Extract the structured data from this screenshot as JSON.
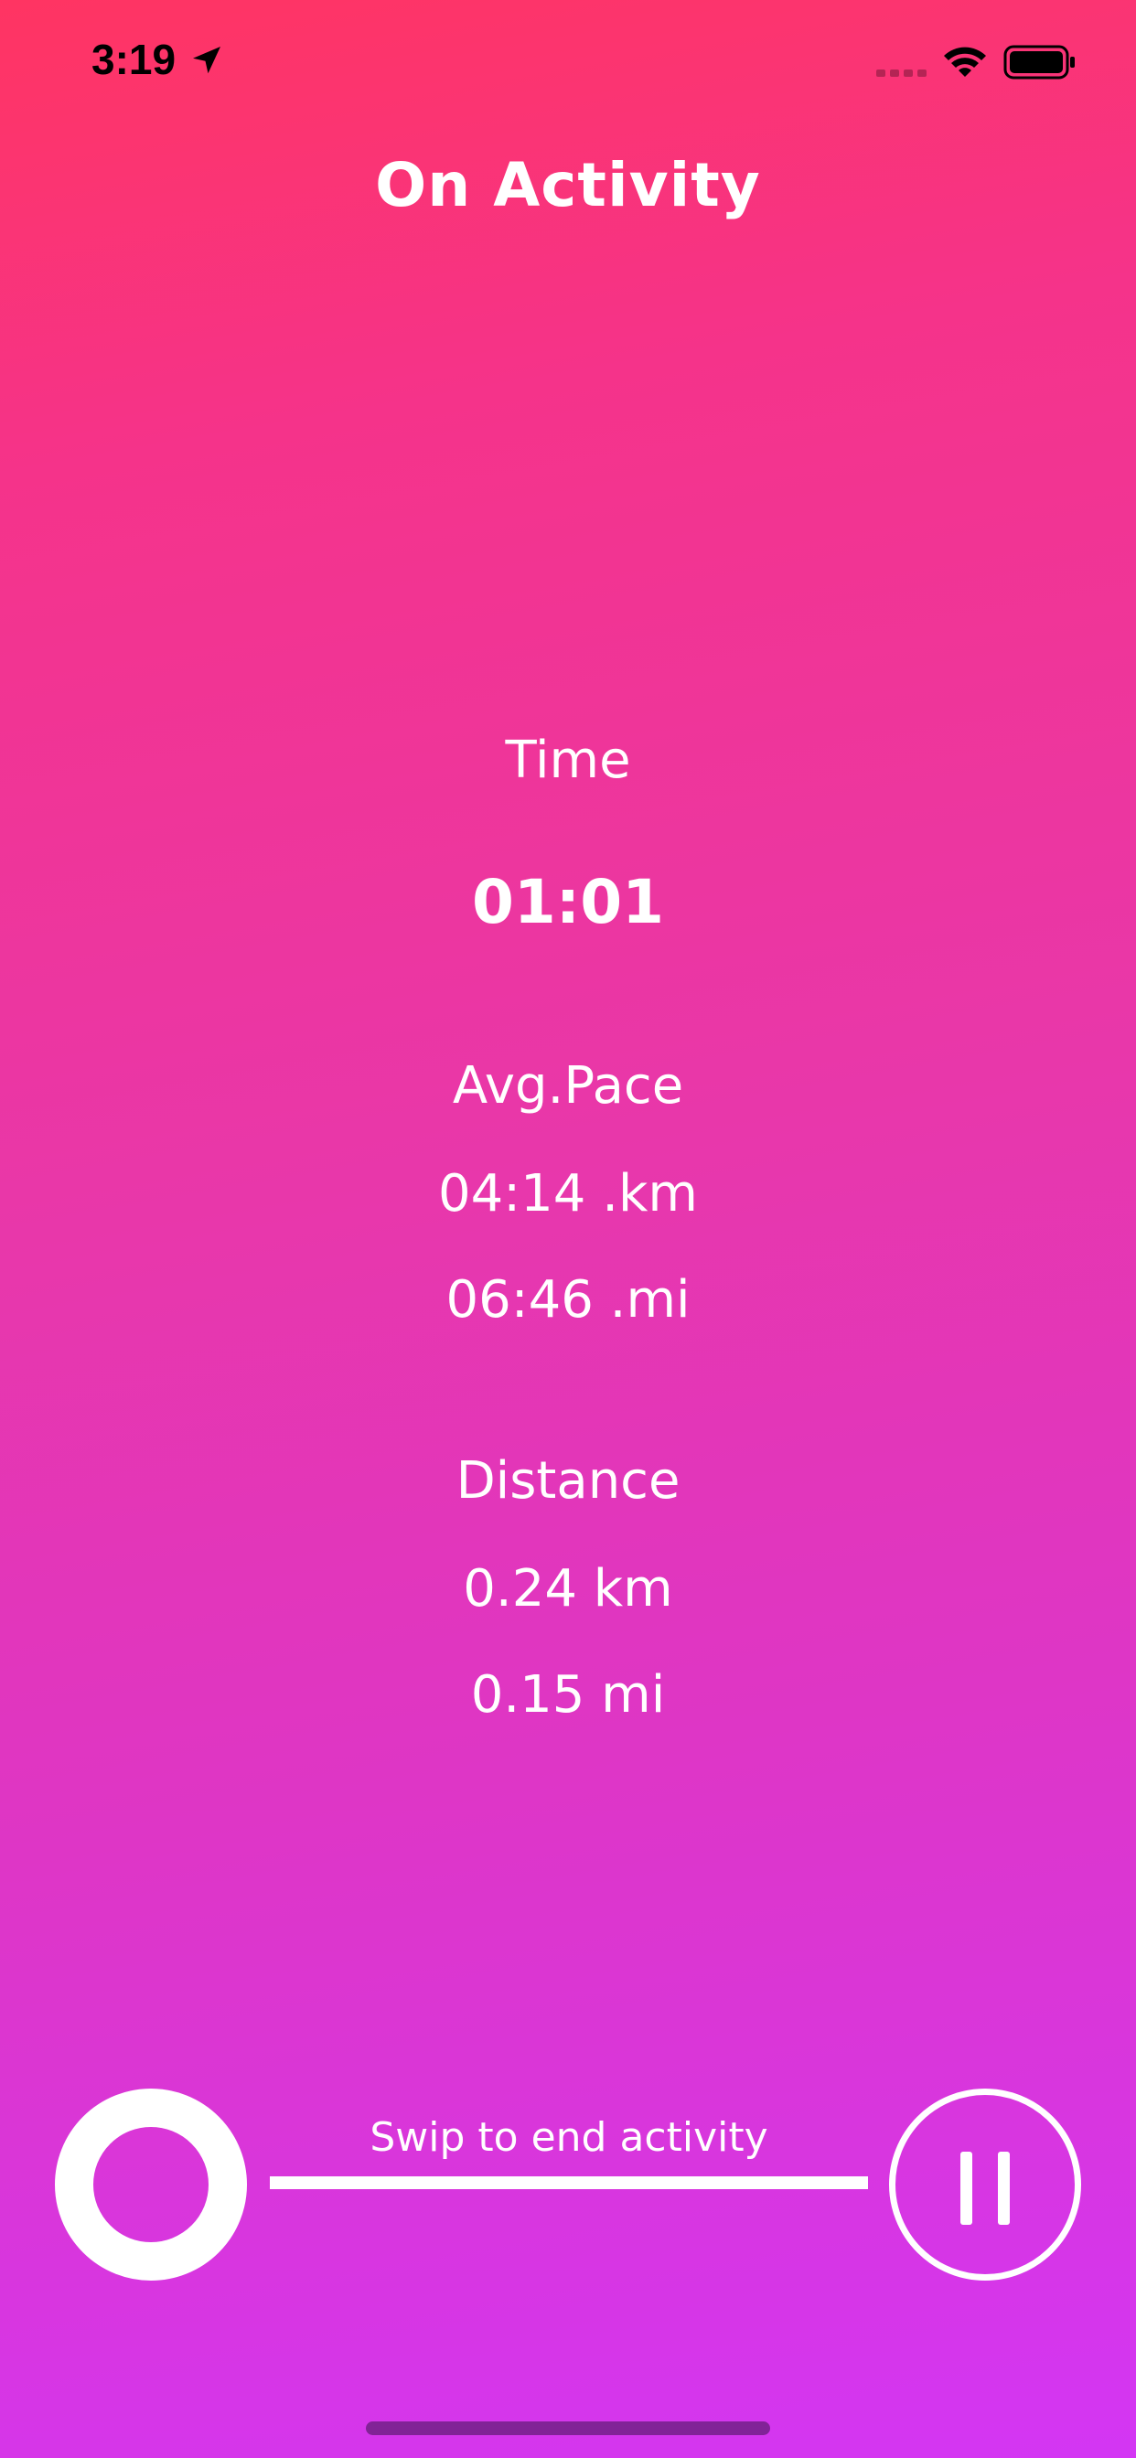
{
  "status_bar": {
    "time": "3:19",
    "icons": [
      "location-arrow-icon",
      "cellular-signal-icon",
      "wifi-icon",
      "battery-icon"
    ]
  },
  "header": {
    "title": "On Activity"
  },
  "stats": {
    "time_label": "Time",
    "time_value": "01:01",
    "pace_label": "Avg.Pace",
    "pace_km": "04:14 .km",
    "pace_mi": "06:46 .mi",
    "distance_label": "Distance",
    "distance_km": "0.24 km",
    "distance_mi": "0.15 mi"
  },
  "controls": {
    "swipe_label": "Swip to end activity",
    "icons": [
      "swipe-handle-icon",
      "pause-icon"
    ]
  },
  "colors": {
    "gradient_top": "#ff3462",
    "gradient_bottom": "#d336f4",
    "text": "#ffffff"
  }
}
